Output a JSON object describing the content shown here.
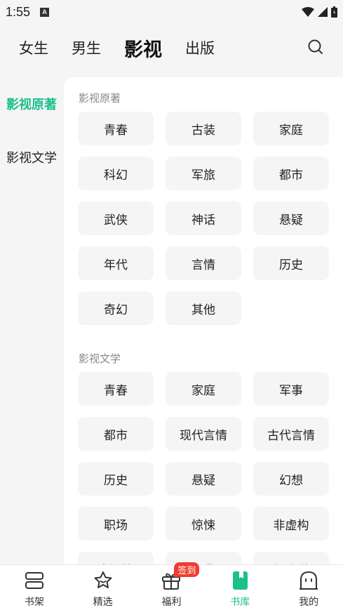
{
  "status": {
    "time": "1:55",
    "a_icon": "A"
  },
  "top_tabs": [
    "女生",
    "男生",
    "影视",
    "出版"
  ],
  "left_nav": [
    "影视原著",
    "影视文学"
  ],
  "sections": [
    {
      "title": "影视原著",
      "tags": [
        "青春",
        "古装",
        "家庭",
        "科幻",
        "军旅",
        "都市",
        "武侠",
        "神话",
        "悬疑",
        "年代",
        "言情",
        "历史",
        "奇幻",
        "其他"
      ]
    },
    {
      "title": "影视文学",
      "tags": [
        "青春",
        "家庭",
        "军事",
        "都市",
        "现代言情",
        "古代言情",
        "历史",
        "悬疑",
        "幻想",
        "职场",
        "惊悚",
        "非虚构",
        "中短篇",
        "经典",
        "轻小说"
      ]
    }
  ],
  "bottom_nav": [
    {
      "label": "书架",
      "icon": "bookshelf-icon"
    },
    {
      "label": "精选",
      "icon": "star-icon"
    },
    {
      "label": "福利",
      "icon": "gift-icon",
      "badge": "签到"
    },
    {
      "label": "书库",
      "icon": "library-icon"
    },
    {
      "label": "我的",
      "icon": "profile-icon"
    }
  ],
  "colors": {
    "accent": "#1bbf8c",
    "badge": "#f23b2f"
  }
}
